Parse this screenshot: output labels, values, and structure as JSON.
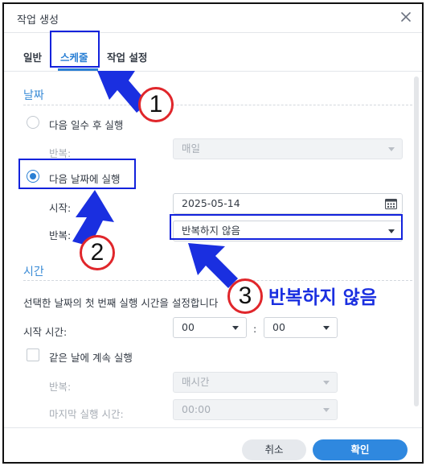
{
  "dialog": {
    "title": "작업 생성"
  },
  "tabs": [
    {
      "label": "일반"
    },
    {
      "label": "스케줄"
    },
    {
      "label": "작업 설정"
    }
  ],
  "date_section": {
    "title": "날짜",
    "option_days": "다음 일수 후 실행",
    "repeat_label_1": "반복:",
    "repeat_value_1": "매일",
    "option_date": "다음 날짜에 실행",
    "start_label": "시작:",
    "start_value": "2025-05-14",
    "repeat_label_2": "반복:",
    "repeat_value_2": "반복하지 않음"
  },
  "time_section": {
    "title": "시간",
    "description": "선택한 날짜의 첫 번째 실행 시간을 설정합니다",
    "start_time_label": "시작 시간:",
    "hour": "00",
    "separator": ":",
    "minute": "00",
    "continue_label": "같은 날에 계속 실행",
    "repeat_label": "반복:",
    "repeat_value": "매시간",
    "last_run_label": "마지막 실행 시간:",
    "last_run_value": "00:00"
  },
  "footer": {
    "cancel": "취소",
    "confirm": "확인"
  },
  "annotations": {
    "marker_1": "1",
    "marker_2": "2",
    "marker_3": "3",
    "callout_text": "반복하지 않음"
  },
  "colors": {
    "accent": "#2a7fd4",
    "annotation_blue": "#1222dc",
    "annotation_red": "#e0262b"
  }
}
